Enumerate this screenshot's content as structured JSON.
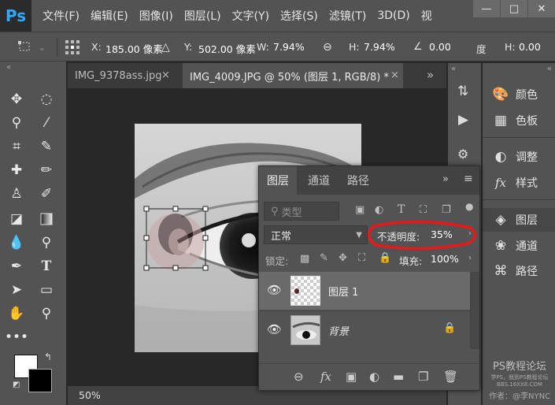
{
  "app": {
    "logo": "Ps"
  },
  "menu": [
    "文件(F)",
    "编辑(E)",
    "图像(I)",
    "图层(L)",
    "文字(Y)",
    "选择(S)",
    "滤镜(T)",
    "3D(D)",
    "视"
  ],
  "window_controls": {
    "minimize": "—",
    "maximize": "□",
    "close": "✕"
  },
  "options": {
    "x_label": "X:",
    "x_value": "185.00 像素",
    "y_label": "Y:",
    "y_value": "502.00 像素",
    "w_label": "W:",
    "w_value": "7.94%",
    "h_label": "H:",
    "h_value": "7.94%",
    "angle_value": "0.00",
    "angle_unit": "度",
    "h2_label": "H:",
    "h2_value": "0.00"
  },
  "tabs": [
    {
      "label": "IMG_9378ass.jpg",
      "close": "×",
      "active": false
    },
    {
      "label": "IMG_4009.JPG @ 50% (图层 1, RGB/8) *",
      "close": "×",
      "active": true
    }
  ],
  "tabs_overflow": "»",
  "status": {
    "zoom": "50%"
  },
  "right_panel": [
    {
      "label": "颜色",
      "icon": "palette-icon"
    },
    {
      "label": "色板",
      "icon": "swatches-grid-icon"
    },
    {
      "label": "调整",
      "icon": "adjustment-circle-icon"
    },
    {
      "label": "样式",
      "icon": "fx-style-icon"
    },
    {
      "label": "图层",
      "icon": "layers-icon",
      "active": true
    },
    {
      "label": "通道",
      "icon": "channels-icon"
    },
    {
      "label": "路径",
      "icon": "paths-icon"
    }
  ],
  "layers_panel": {
    "tabs": [
      "图层",
      "通道",
      "路径"
    ],
    "filter_kind": "类型",
    "blend_mode": "正常",
    "opacity_label": "不透明度:",
    "opacity_value": "35%",
    "lock_label": "锁定:",
    "fill_label": "填充:",
    "fill_value": "100%",
    "layers": [
      {
        "name": "图层 1",
        "visible": true,
        "selected": true
      },
      {
        "name": "背景",
        "visible": true,
        "locked": true
      }
    ]
  },
  "colors": {
    "accent_red": "#e8181b",
    "panel_bg": "#535353",
    "selected_layer": "#6a6a6a"
  },
  "watermark": {
    "title": "PS教程论坛",
    "sub1": "学PS，就到PS教程论坛",
    "sub2": "BBS.16XX8.COM",
    "author": "作者：@李NYNC"
  }
}
